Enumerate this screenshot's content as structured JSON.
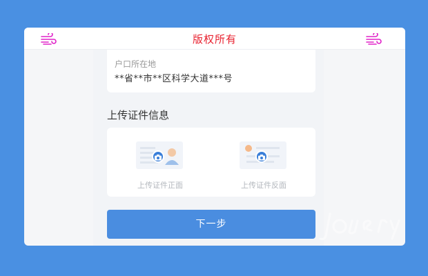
{
  "header": {
    "title": "版权所有",
    "left_icon": "wind-icon",
    "right_icon": "wind-icon",
    "accent_color": "#e8212f",
    "icon_color": "#e020c8"
  },
  "address": {
    "label": "户口所在地",
    "value": "**省**市**区科学大道***号"
  },
  "upload": {
    "section_title": "上传证件信息",
    "front_label": "上传证件正面",
    "back_label": "上传证件反面"
  },
  "next_button": {
    "label": "下一步",
    "color": "#4a8de0"
  },
  "background_color": "#4a90e2"
}
